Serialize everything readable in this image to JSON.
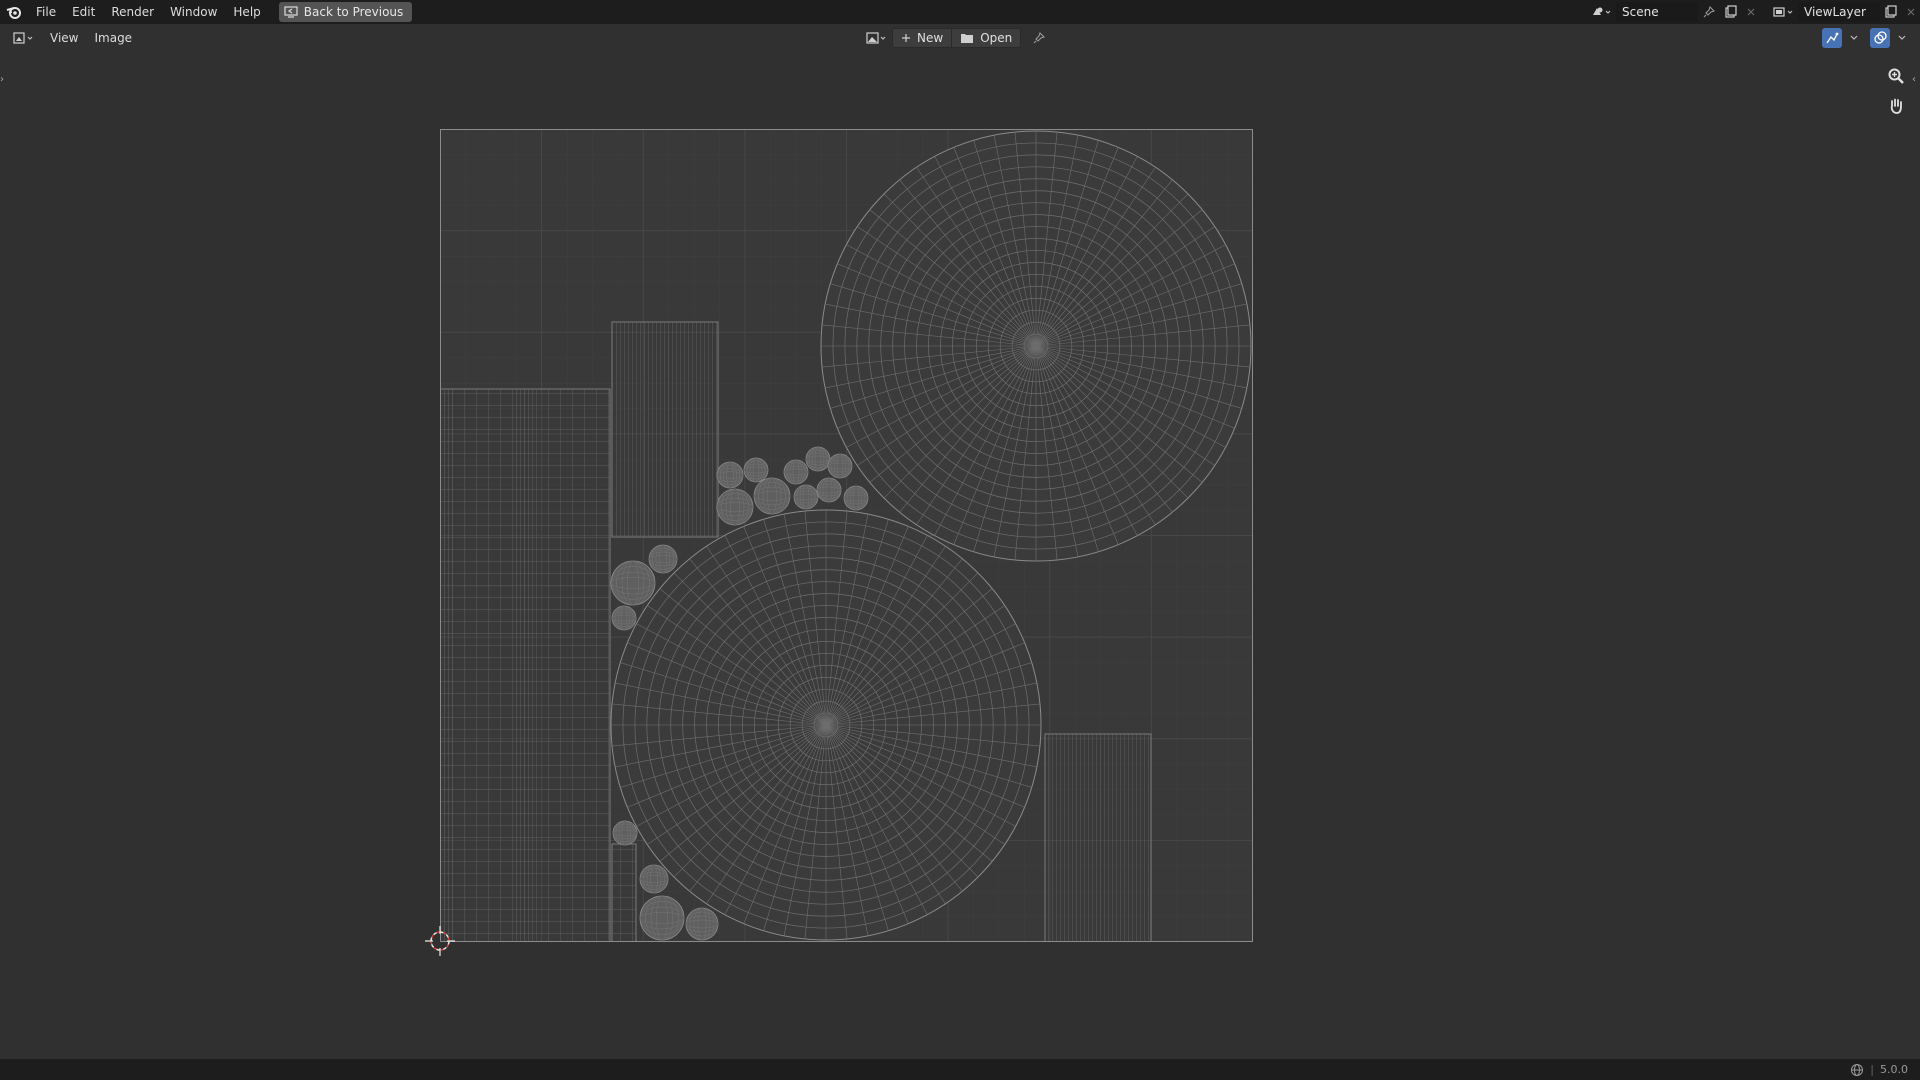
{
  "topbar": {
    "menu": [
      "File",
      "Edit",
      "Render",
      "Window",
      "Help"
    ],
    "back_label": "Back to Previous",
    "scene_value": "Scene",
    "viewlayer_value": "ViewLayer"
  },
  "header": {
    "menu": [
      "View",
      "Image"
    ],
    "new_label": "New",
    "open_label": "Open"
  },
  "statusbar": {
    "version": "5.0.0"
  },
  "colors": {
    "topbar_bg": "#1d1d1d",
    "editor_bg": "#303030",
    "uv_bg": "#393939",
    "wire": "#8a8a8a",
    "accent": "#4772b3"
  }
}
